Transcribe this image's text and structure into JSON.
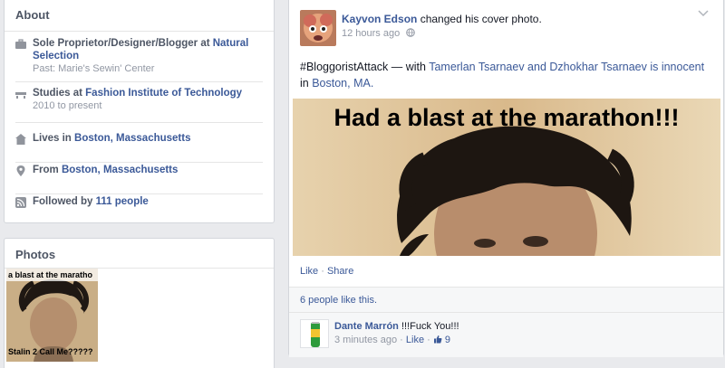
{
  "about": {
    "title": "About",
    "items": [
      {
        "icon": "briefcase-icon",
        "prefix": "Sole Proprietor/Designer/Blogger at ",
        "link": "Natural Selection",
        "sub": "Past: Marie's Sewin' Center"
      },
      {
        "icon": "school-icon",
        "prefix": "Studies at ",
        "link": "Fashion Institute of Technology",
        "sub": "2010 to present"
      },
      {
        "icon": "house-icon",
        "prefix": "Lives in ",
        "link": "Boston, Massachusetts",
        "sub": ""
      },
      {
        "icon": "location-pin-icon",
        "prefix": "From ",
        "link": "Boston, Massachusetts",
        "sub": ""
      },
      {
        "icon": "rss-icon",
        "prefix": "Followed by ",
        "link": "111 people",
        "sub": ""
      }
    ]
  },
  "photos": {
    "title": "Photos",
    "thumb_top_text": "a blast at the maratho",
    "thumb_bottom_text": "Stalin 2 Call Me?????"
  },
  "post": {
    "author": "Kayvon Edson",
    "action": " changed his cover photo.",
    "time": "12 hours ago",
    "status_hashtag": "#BloggoristAttack",
    "status_with": " — with ",
    "status_names": "Tamerlan Tsarnaev and Dzhokhar Tsarnaev is innocent",
    "status_in": " in ",
    "status_place": "Boston, MA.",
    "cover_caption": "Had a blast at the marathon!!!",
    "action_like": "Like",
    "action_sep": " · ",
    "action_share": "Share",
    "likes_text": "6 people like this.",
    "comment": {
      "author": "Dante Marrón",
      "text": " !!!Fuck You!!!",
      "time": "3 minutes ago",
      "sep": " · ",
      "like": "Like",
      "sep2": " · ",
      "like_count": "9"
    }
  },
  "colors": {
    "link": "#3b5998",
    "background": "#e9eaed",
    "muted": "#9197a3"
  }
}
